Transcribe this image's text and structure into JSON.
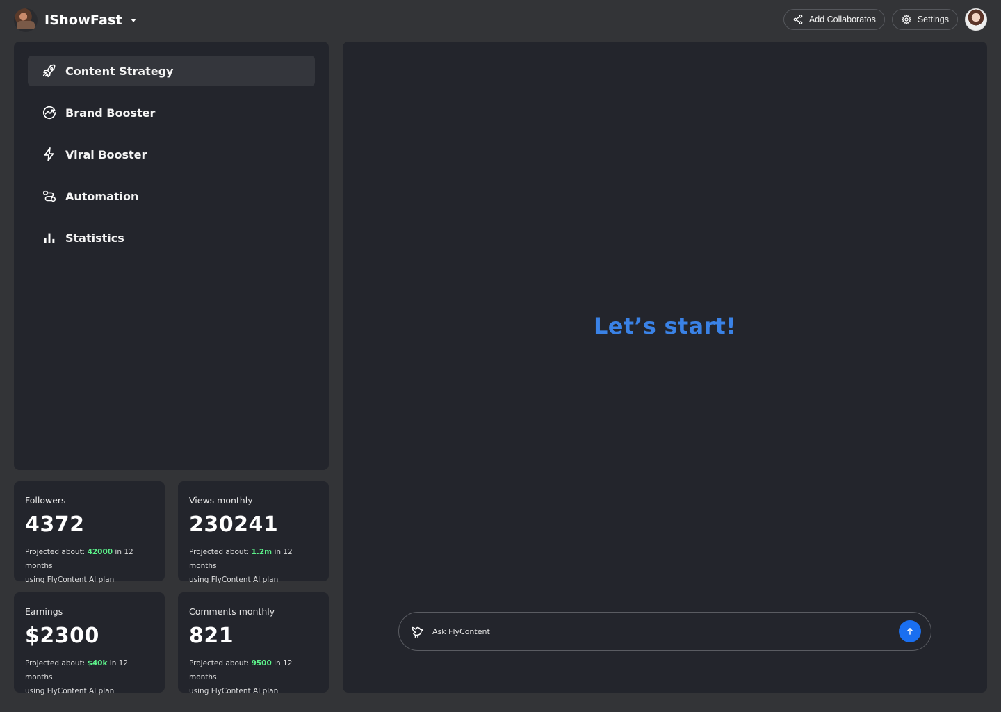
{
  "header": {
    "brand_name": "IShowFast",
    "add_collaborators_label": "Add Collaboratos",
    "settings_label": "Settings"
  },
  "sidebar": {
    "items": [
      {
        "label": "Content Strategy",
        "icon": "rocket-icon",
        "active": true
      },
      {
        "label": "Brand Booster",
        "icon": "trend-circle-icon",
        "active": false
      },
      {
        "label": "Viral Booster",
        "icon": "lightning-icon",
        "active": false
      },
      {
        "label": "Automation",
        "icon": "route-icon",
        "active": false
      },
      {
        "label": "Statistics",
        "icon": "bar-chart-icon",
        "active": false
      }
    ]
  },
  "stats": [
    {
      "title": "Followers",
      "value": "4372",
      "note_prefix": "Projected about: ",
      "highlight": "42000",
      "note_suffix": " in 12 months",
      "note_line2": "using FlyContent AI plan"
    },
    {
      "title": "Views monthly",
      "value": "230241",
      "note_prefix": "Projected about: ",
      "highlight": "1.2m",
      "note_suffix": " in 12 months",
      "note_line2": "using FlyContent AI plan"
    },
    {
      "title": "Earnings",
      "value": "$2300",
      "note_prefix": "Projected about: ",
      "highlight": "$40k",
      "note_suffix": " in 12 months",
      "note_line2": "using FlyContent AI plan"
    },
    {
      "title": "Comments monthly",
      "value": "821",
      "note_prefix": "Projected about: ",
      "highlight": "9500",
      "note_suffix": " in 12 months",
      "note_line2": "using FlyContent AI plan"
    }
  ],
  "main": {
    "hero_text": "Let’s start!",
    "ask_placeholder": "Ask FlyContent"
  },
  "colors": {
    "accent_blue": "#3a82e6",
    "send_blue": "#1a6ff0",
    "highlight_green": "#5cf28a",
    "panel": "#23252c",
    "background": "#333437"
  }
}
